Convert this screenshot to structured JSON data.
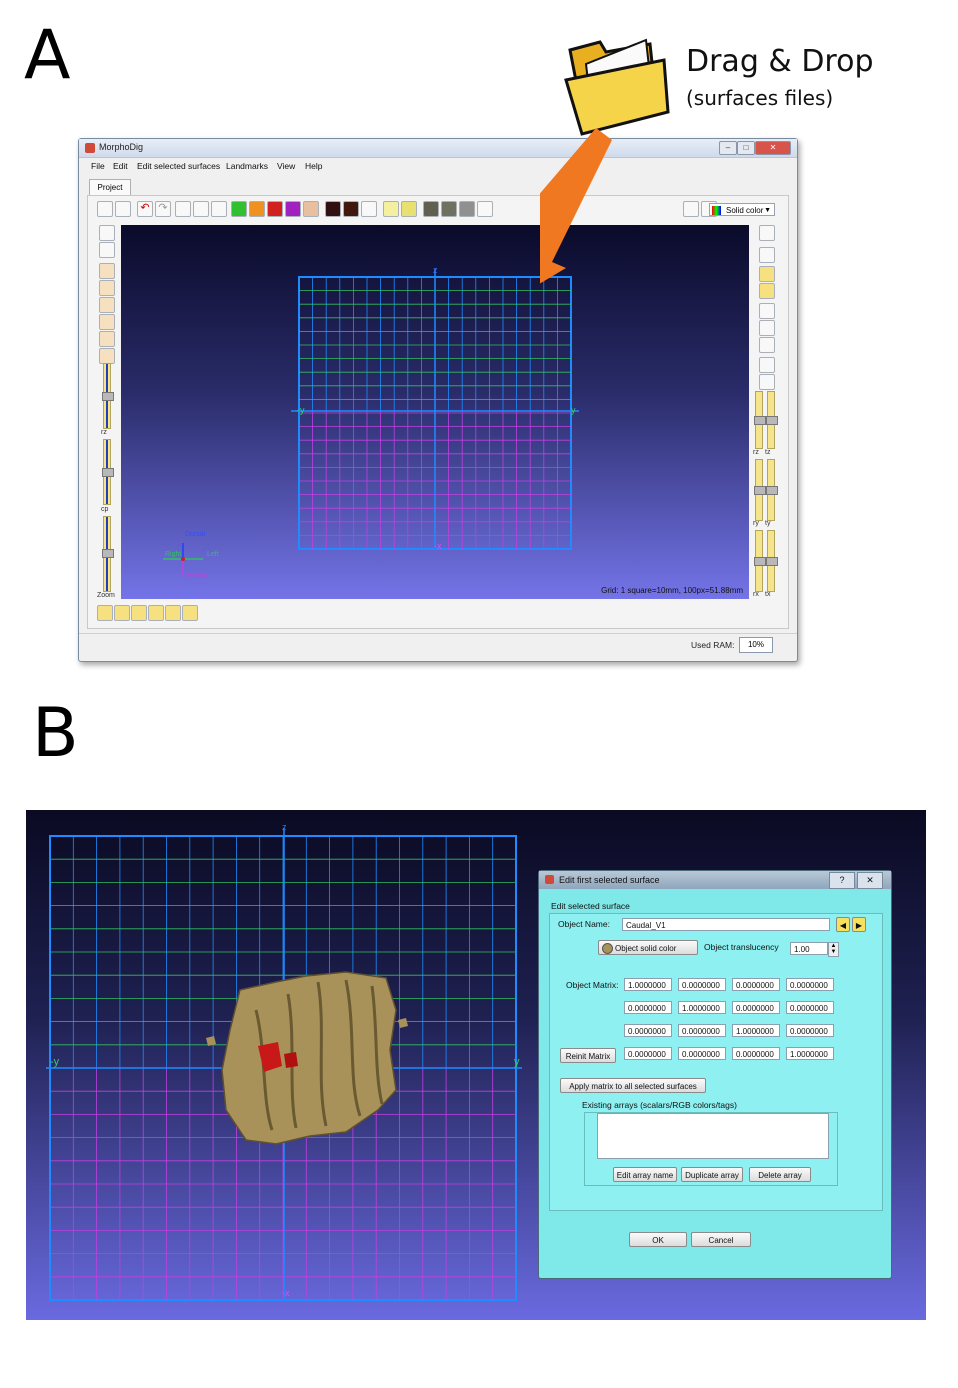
{
  "panels": {
    "a_label": "A",
    "b_label": "B"
  },
  "drag_drop": {
    "title": "Drag & Drop",
    "subtitle": "(surfaces files)"
  },
  "window": {
    "title": "MorphoDig",
    "menu": [
      "File",
      "Edit",
      "Edit selected surfaces",
      "Landmarks",
      "View",
      "Help"
    ],
    "tab": "Project",
    "render_mode": "Solid color",
    "grid_info": "Grid: 1 square=10mm, 100px=51.88mm",
    "left_labels": {
      "rz": "rz",
      "cp": "cp",
      "zoom": "Zoom"
    },
    "right_labels": {
      "rz": "rz",
      "tz": "tz",
      "ry": "ry",
      "ty": "ty",
      "rx": "rx",
      "tx": "tx"
    },
    "axes": {
      "z": "z",
      "y_neg": "-y",
      "y": "y",
      "x_neg": "-x"
    },
    "orientation": {
      "dorsal": "Dorsal",
      "right": "Right",
      "left": "Left",
      "ventral": "Ventral"
    },
    "ram_label": "Used RAM:",
    "ram_value": "10%"
  },
  "dialog": {
    "title": "Edit first selected surface",
    "help": "?",
    "close": "✕",
    "group_title": "Edit selected surface",
    "object_name_label": "Object Name:",
    "object_name_value": "Caudal_V1",
    "solid_color_button": "Object solid color",
    "translucency_label": "Object translucency",
    "translucency_value": "1.00",
    "matrix_label": "Object Matrix:",
    "matrix": [
      [
        "1.0000000",
        "0.0000000",
        "0.0000000",
        "0.0000000"
      ],
      [
        "0.0000000",
        "1.0000000",
        "0.0000000",
        "0.0000000"
      ],
      [
        "0.0000000",
        "0.0000000",
        "1.0000000",
        "0.0000000"
      ],
      [
        "0.0000000",
        "0.0000000",
        "0.0000000",
        "1.0000000"
      ]
    ],
    "reinit_button": "Reinit Matrix",
    "apply_button": "Apply matrix to all selected surfaces",
    "arrays_label": "Existing arrays (scalars/RGB colors/tags)",
    "edit_array_button": "Edit array name",
    "duplicate_array_button": "Duplicate array",
    "delete_array_button": "Delete array",
    "ok_button": "OK",
    "cancel_button": "Cancel"
  },
  "colors": {
    "arrow": "#f07820",
    "dialog_bg": "#8ef0f0",
    "grid_blue": "#1e8cff",
    "grid_green": "#30c060",
    "grid_magenta": "#c040e0",
    "bone": "#a8925a"
  }
}
